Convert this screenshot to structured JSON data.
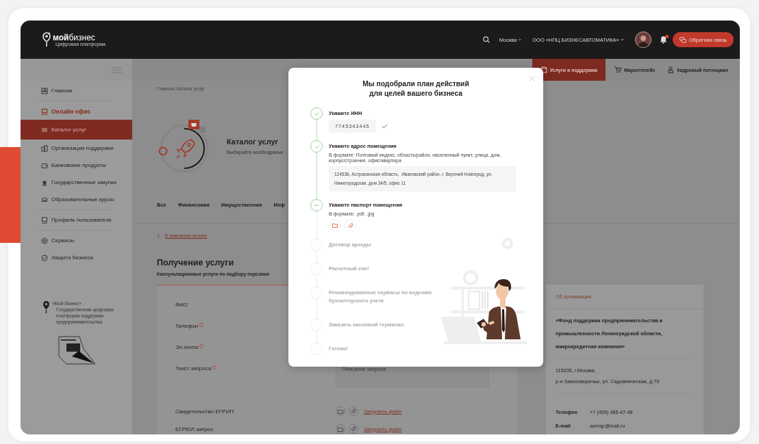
{
  "header": {
    "logo": {
      "name": "**мой**бизнес",
      "tagline": "Цифровая платформа"
    },
    "region": "Москва",
    "company": "ООО «НПЦ БИЗНЕСАВТОМАТИКА»",
    "notifications": {
      "unread": true
    },
    "feedback_button": "Обратная связь"
  },
  "sidebar": {
    "groups": [
      {
        "items": [
          {
            "label": "Главная",
            "accent": false,
            "selected": false
          }
        ]
      },
      {
        "items": [
          {
            "label": "Онлайн офис",
            "accent": true,
            "selected": false
          },
          {
            "label": "Каталог услуг",
            "accent": false,
            "selected": true
          },
          {
            "label": "Организации поддержки",
            "accent": false,
            "selected": false
          },
          {
            "label": "Банковские продукты",
            "accent": false,
            "selected": false
          },
          {
            "label": "Государственные закупки",
            "accent": false,
            "selected": false
          },
          {
            "label": "Образовательные курсы",
            "accent": false,
            "selected": false
          }
        ]
      },
      {
        "items": [
          {
            "label": "Профиль пользователя",
            "accent": false,
            "selected": false
          }
        ]
      },
      {
        "items": [
          {
            "label": "Сервисы",
            "accent": false,
            "selected": false
          },
          {
            "label": "Защита бизнеса",
            "accent": false,
            "selected": false
          }
        ]
      }
    ],
    "footer": {
      "title": "«Мой бизнес»",
      "text": "Государственная цифровая платформа поддержки предпринимательства"
    }
  },
  "top_nav": [
    {
      "label": "Услуги и поддержка",
      "selected": true
    },
    {
      "label": "Маркетплейс",
      "selected": false
    },
    {
      "label": "Кадровый потенциал",
      "selected": false
    }
  ],
  "breadcrumb": "Главная/ Каталог услуг",
  "catalog": {
    "title": "Каталог услуг",
    "subtitle": "Выбирайте необходимые"
  },
  "category_tabs": [
    "Все",
    "Финансовая",
    "Имущественная",
    "Инф"
  ],
  "back_link": "К описанию услуги",
  "service": {
    "title": "Получение услуги",
    "subtitle": "Консультационные услуги по подбору персонал"
  },
  "form": {
    "fields": [
      {
        "label": "ФИО",
        "required": false,
        "kind": "text"
      },
      {
        "label": "Телефон",
        "required": true,
        "kind": "text"
      },
      {
        "label": "Эл.почта",
        "required": true,
        "kind": "text"
      },
      {
        "label": "Текст запроса",
        "required": true,
        "kind": "textarea",
        "placeholder": "Описание запроса"
      },
      {
        "label": "Свидетельство ЕГРИП",
        "required": false,
        "kind": "file",
        "action": "Загрузить файл"
      },
      {
        "label": "ЕГРЮЛ запрос",
        "required": false,
        "kind": "file",
        "action": "Загрузить файл"
      }
    ]
  },
  "organization": {
    "heading": "Об организации",
    "name": "«Фонд поддержки предпринимательства и промышленности Ленинградской области, микрокредитная компания»",
    "address": [
      "115035, г.Москва,",
      "р-н Замоскворечье, ул. Садовническая, д.79"
    ],
    "contacts": [
      {
        "label": "Телефон",
        "value": "+7 (495) 465-47-46"
      },
      {
        "label": "E-mail",
        "value": "aomsp@mail.ru"
      }
    ]
  },
  "modal": {
    "title_lines": [
      "Мы подобрали план действий",
      "для целей вашего бизнеса"
    ],
    "steps": [
      {
        "title": "Укажите ИНН",
        "done": true,
        "current": false,
        "kind": "input",
        "value": "7745343445",
        "valid": true
      },
      {
        "title": "Укажите адрес помещения",
        "done": true,
        "current": false,
        "kind": "textarea",
        "hint": "В формате: Почтовый индекс, область/район, населенный пункт, улица, дом, корпус/строение, офис/квартира",
        "value": "124536, Астраханская область,  Ивановский район, г. Верхний Новгород, ул. Нижегородская, дом 34/5, офис 11"
      },
      {
        "title": "Укажите паспорт помещения",
        "done": false,
        "current": true,
        "kind": "upload",
        "hint": "В формате: .pdf, .jpg"
      },
      {
        "title": "Договор аренды",
        "done": false,
        "current": false
      },
      {
        "title": "Расчетный счет",
        "done": false,
        "current": false
      },
      {
        "title": "Рекомендованные сервисы по ведению бухгалтерского учета",
        "done": false,
        "current": false
      },
      {
        "title": "Заказать кассовый терминал",
        "done": false,
        "current": false
      },
      {
        "title": "Готово!",
        "done": false,
        "current": false
      }
    ]
  }
}
